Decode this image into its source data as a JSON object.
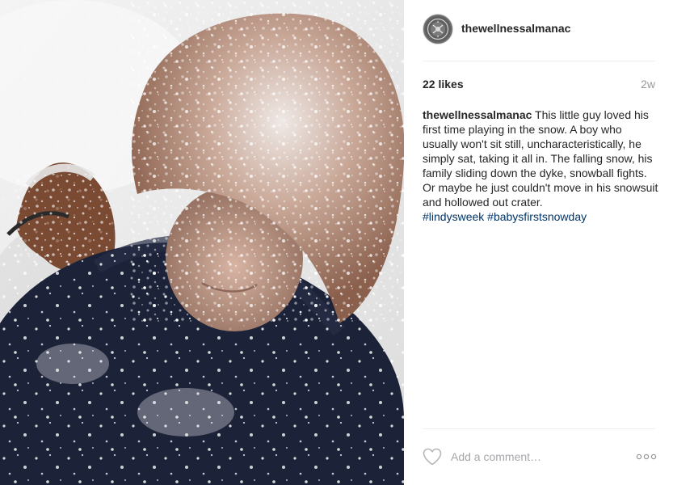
{
  "post": {
    "username": "thewellnessalmanac",
    "avatar_icon": "seal-logo-icon",
    "likes": "22 likes",
    "age": "2w",
    "caption": {
      "username": "thewellnessalmanac",
      "text": "This little guy loved his first time playing in the snow. A boy who usually won't sit still, uncharacteristically, he simply sat, taking it all in. The falling snow, his family sliding down the dyke, snowball fights. Or maybe he just couldn't move in his snowsuit and hollowed out crater.",
      "hashtags": [
        "#lindysweek",
        "#babysfirstsnowday"
      ]
    },
    "comment": {
      "placeholder": "Add a comment…"
    },
    "icons": {
      "like": "heart-outline-icon",
      "more": "more-options-icon"
    },
    "colors": {
      "text": "#262626",
      "muted": "#999999",
      "hashtag": "#003569",
      "divider": "#efefef",
      "placeholder": "#a5a7aa"
    }
  }
}
